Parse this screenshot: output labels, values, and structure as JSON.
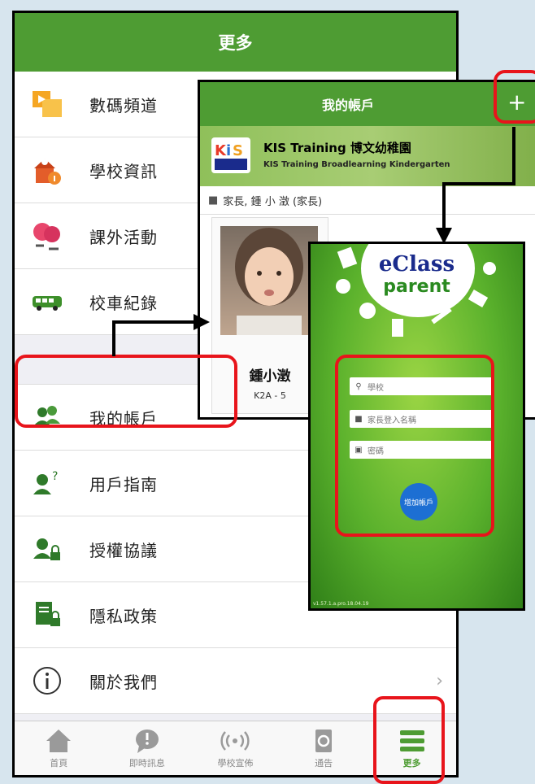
{
  "main": {
    "title": "更多",
    "menu": [
      {
        "label": "數碼頻道",
        "icon": "media-channel-icon"
      },
      {
        "label": "學校資訊",
        "icon": "school-info-icon"
      },
      {
        "label": "課外活動",
        "icon": "activities-icon"
      },
      {
        "label": "校車紀錄",
        "icon": "bus-icon"
      },
      {
        "label": "我的帳戶",
        "icon": "account-icon"
      },
      {
        "label": "用戶指南",
        "icon": "user-guide-icon"
      },
      {
        "label": "授權協議",
        "icon": "license-icon"
      },
      {
        "label": "隱私政策",
        "icon": "privacy-icon"
      },
      {
        "label": "關於我們",
        "icon": "info-icon"
      }
    ],
    "tabs": [
      {
        "label": "首頁",
        "icon": "home-icon"
      },
      {
        "label": "即時訊息",
        "icon": "message-icon"
      },
      {
        "label": "學校宣佈",
        "icon": "broadcast-icon"
      },
      {
        "label": "通告",
        "icon": "notice-icon"
      },
      {
        "label": "更多",
        "icon": "menu-icon"
      }
    ]
  },
  "account": {
    "title": "我的帳戶",
    "add": "+",
    "school_name": "KIS Training 博文幼稚園",
    "school_name_en": "KIS Training Broadlearning Kindergarten",
    "parent": "家長, 鍾 小 澂 (家長)",
    "child_name": "鍾小澂",
    "child_class": "K2A - 5"
  },
  "login": {
    "brand1": "eClass",
    "brand2": "parent",
    "school_placeholder": "學校",
    "login_placeholder": "家長登入名稱",
    "password_placeholder": "密碼",
    "add_button": "增加帳戶",
    "version": "v1.57.1.a.pro.18.04.19"
  },
  "colors": {
    "brand_green": "#4e9c33",
    "highlight_red": "#e8141b",
    "button_blue": "#1d6fd3"
  }
}
